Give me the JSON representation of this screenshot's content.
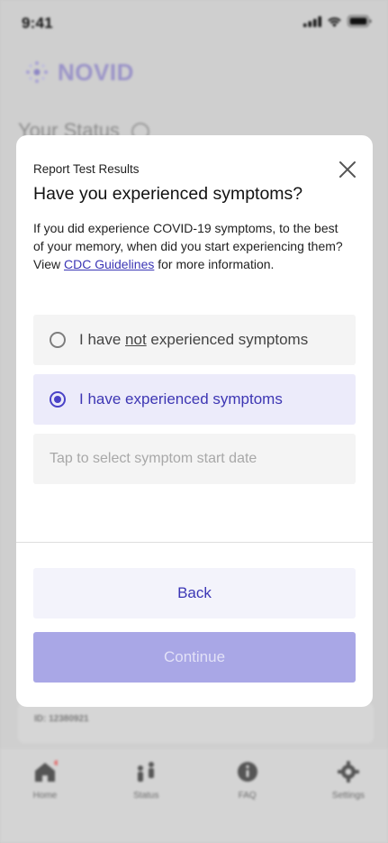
{
  "status_bar": {
    "time": "9:41",
    "icons": [
      "cellular-signal-icon",
      "wifi-icon",
      "battery-icon"
    ]
  },
  "app": {
    "brand": "NOVID",
    "section_title": "Your Status",
    "id_text": "ID: 12380921",
    "tabs": [
      {
        "label": "Home",
        "icon": "home-icon",
        "has_badge": true
      },
      {
        "label": "Status",
        "icon": "people-icon"
      },
      {
        "label": "FAQ",
        "icon": "info-icon"
      },
      {
        "label": "Settings",
        "icon": "gear-icon"
      }
    ]
  },
  "modal": {
    "eyebrow": "Report Test Results",
    "title": "Have you experienced symptoms?",
    "description_pre": "If you did experience COVID-19 symptoms, to the best of your memory, when did you start experiencing them? View ",
    "description_link": "CDC Guidelines",
    "description_post": " for more information.",
    "options": {
      "not_experienced": {
        "prefix": "I have ",
        "emphasis": "not",
        "suffix": " experienced symptoms",
        "selected": false
      },
      "experienced": {
        "label": "I have experienced symptoms",
        "selected": true
      }
    },
    "date_placeholder": "Tap to select symptom start date",
    "back_label": "Back",
    "continue_label": "Continue",
    "continue_enabled": false
  },
  "colors": {
    "accent": "#4a42c7",
    "accent_light": "#ecebfa",
    "continue_disabled": "#a9a7e6"
  }
}
